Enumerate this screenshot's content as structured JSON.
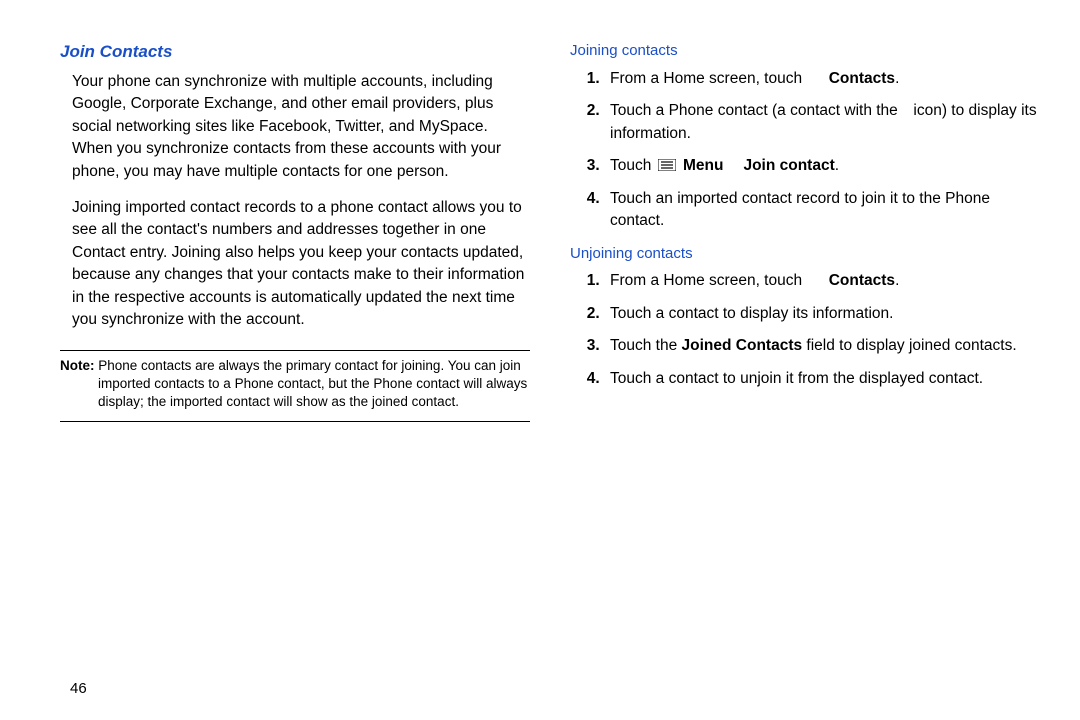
{
  "left": {
    "title": "Join Contacts",
    "p1": "Your phone can synchronize with multiple accounts, including Google, Corporate Exchange, and other email providers, plus social networking sites like Facebook, Twitter, and MySpace. When you synchronize contacts from these accounts with your phone, you may have multiple contacts for one person.",
    "p2": "Joining imported contact records to a phone contact allows you to see all the contact's numbers and addresses together in one Contact entry. Joining also helps you keep your contacts updated, because any changes that your contacts make to their information in the respective accounts is automatically updated the next time you synchronize with the account.",
    "note_label": "Note:",
    "note_body": "Phone contacts are always the primary contact for joining. You can join imported contacts to a Phone contact, but the Phone contact will always display; the imported contact will show as the joined contact."
  },
  "right": {
    "join_title": "Joining contacts",
    "j1_a": "From a Home screen, touch ",
    "j1_b": "Contacts",
    "j1_c": ".",
    "j2_a": "Touch a Phone contact (a contact with the ",
    "j2_b": " icon) to display its information.",
    "j3_a": "Touch ",
    "j3_menu": "Menu",
    "j3_gap": " ",
    "j3_join": "Join contact",
    "j3_end": ".",
    "j4": "Touch an imported contact record to join it to the Phone contact.",
    "unjoin_title": "Unjoining contacts",
    "u1_a": "From a Home screen, touch ",
    "u1_b": "Contacts",
    "u1_c": ".",
    "u2": "Touch a contact to display its information.",
    "u3_a": "Touch the ",
    "u3_b": "Joined Contacts",
    "u3_c": " field to display joined contacts.",
    "u4": "Touch a contact to unjoin it from the displayed contact."
  },
  "page_number": "46"
}
